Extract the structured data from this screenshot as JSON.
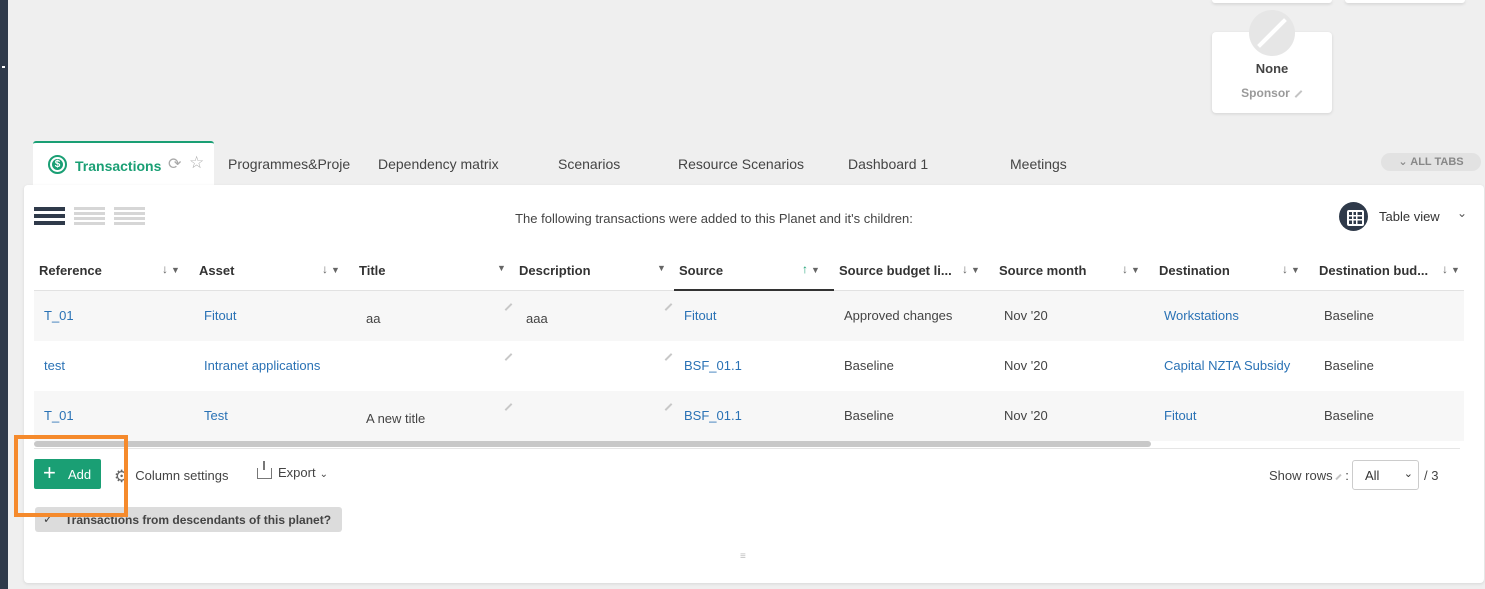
{
  "sponsor": {
    "name": "None",
    "role": "Sponsor"
  },
  "tabs": {
    "active": {
      "label": "Transactions"
    },
    "items": [
      "Programmes&Proje",
      "Dependency matrix",
      "Scenarios",
      "Resource Scenarios",
      "Dashboard 1",
      "Meetings"
    ],
    "all_tabs_label": "ALL TABS"
  },
  "panel": {
    "caption": "The following transactions were added to this Planet and it's children:",
    "view_mode": "Table view"
  },
  "table": {
    "columns": [
      "Reference",
      "Asset",
      "Title",
      "Description",
      "Source",
      "Source budget li...",
      "Source month",
      "Destination",
      "Destination bud..."
    ],
    "rows": [
      [
        "T_01",
        "Fitout",
        "aa",
        "aaa",
        "Fitout",
        "Approved changes",
        "Nov '20",
        "Workstations",
        "Baseline"
      ],
      [
        "test",
        "Intranet applications",
        "",
        "",
        "BSF_01.1",
        "Baseline",
        "Nov '20",
        "Capital NZTA Subsidy",
        "Baseline"
      ],
      [
        "T_01",
        "Test",
        "A new title",
        "",
        "BSF_01.1",
        "Baseline",
        "Nov '20",
        "Fitout",
        "Baseline"
      ]
    ]
  },
  "footer": {
    "add_label": "Add",
    "column_settings_label": "Column settings",
    "export_label": "Export",
    "show_rows_label": "Show rows",
    "rows_value": "All",
    "page_total": "/ 3",
    "descendants_label": "Transactions from descendants of this planet?"
  },
  "colors": {
    "accent": "#1a9f74",
    "link": "#2a72b5",
    "highlight": "#f58a2c",
    "dark": "#2f3a4a"
  }
}
